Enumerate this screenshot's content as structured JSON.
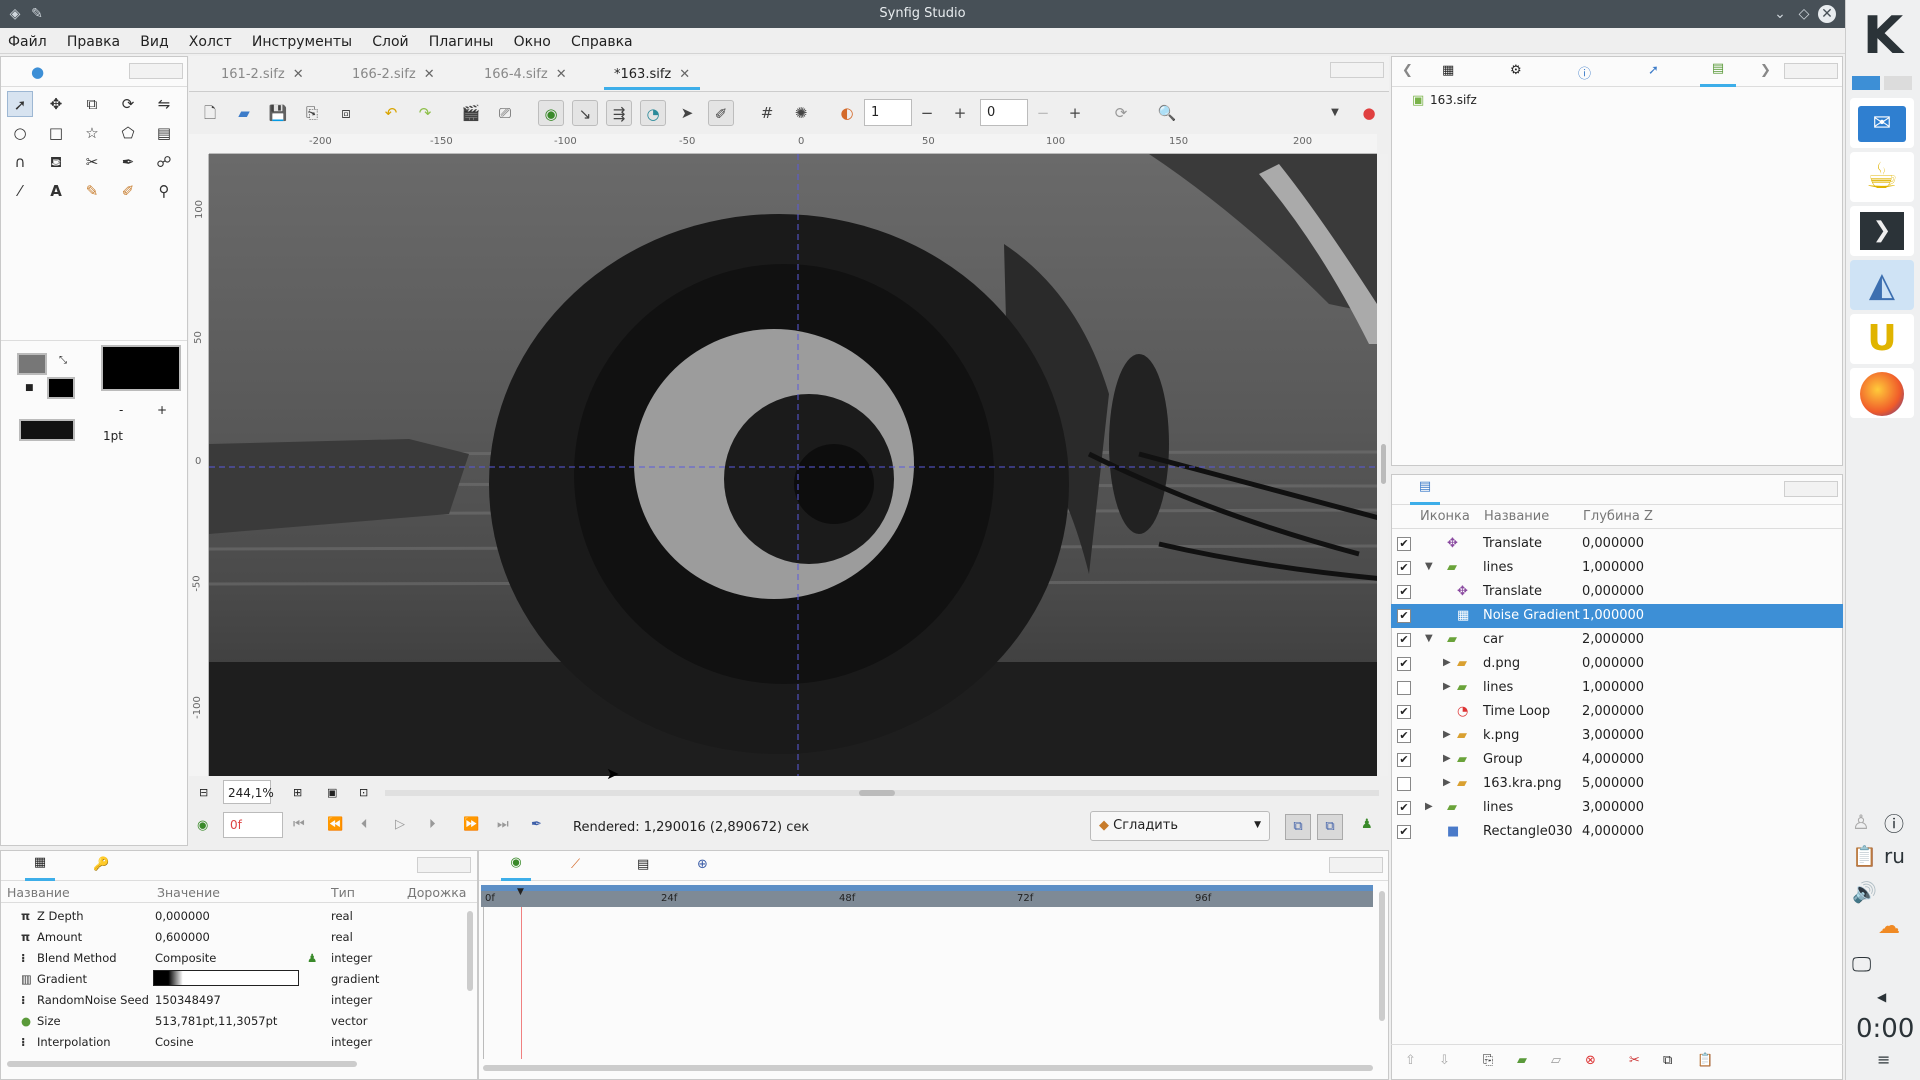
{
  "window": {
    "title": "Synfig Studio"
  },
  "menu": [
    "Файл",
    "Правка",
    "Вид",
    "Холст",
    "Инструменты",
    "Слой",
    "Плагины",
    "Окно",
    "Справка"
  ],
  "tabs": [
    {
      "label": "161-2.sifz",
      "active": false
    },
    {
      "label": "166-2.sifz",
      "active": false
    },
    {
      "label": "166-4.sifz",
      "active": false
    },
    {
      "label": "*163.sifz",
      "active": true
    }
  ],
  "toolbar": {
    "frame_value": "1",
    "offset_value": "0"
  },
  "brush": {
    "size_label": "1pt",
    "minus": "-",
    "plus": "+"
  },
  "ruler": {
    "h_labels": [
      "-200",
      "-150",
      "-100",
      "-50",
      "0",
      "50",
      "100",
      "150",
      "200"
    ],
    "v_labels": [
      "100",
      "50",
      "0",
      "-50",
      "-100"
    ]
  },
  "canvas_footer": {
    "zoom": "244,1%",
    "frame": "0f",
    "render_status": "Rendered: 1,290016 (2,890672) сек",
    "interpolation": "Сгладить"
  },
  "library": {
    "file": "163.sifz"
  },
  "layers": {
    "headers": {
      "icon": "Иконка",
      "name": "Название",
      "depth": "Глубина Z"
    },
    "rows": [
      {
        "name": "Translate",
        "depth": "0,000000",
        "checked": true,
        "indent": 0,
        "icon": "translate-icon",
        "expander": ""
      },
      {
        "name": "lines",
        "depth": "1,000000",
        "checked": true,
        "indent": 0,
        "icon": "folder-icon",
        "expander": "open"
      },
      {
        "name": "Translate",
        "depth": "0,000000",
        "checked": true,
        "indent": 1,
        "icon": "translate-icon",
        "expander": ""
      },
      {
        "name": "Noise Gradient",
        "depth": "1,000000",
        "checked": true,
        "indent": 1,
        "icon": "noise-gradient-icon",
        "expander": "",
        "selected": true
      },
      {
        "name": "car",
        "depth": "2,000000",
        "checked": true,
        "indent": 0,
        "icon": "folder-icon",
        "expander": "open"
      },
      {
        "name": "d.png",
        "depth": "0,000000",
        "checked": true,
        "indent": 1,
        "icon": "folder-image-icon",
        "expander": "closed"
      },
      {
        "name": "lines",
        "depth": "1,000000",
        "checked": false,
        "indent": 1,
        "icon": "folder-icon",
        "expander": "closed"
      },
      {
        "name": "Time Loop",
        "depth": "2,000000",
        "checked": true,
        "indent": 1,
        "icon": "time-loop-icon",
        "expander": ""
      },
      {
        "name": "k.png",
        "depth": "3,000000",
        "checked": true,
        "indent": 1,
        "icon": "folder-image-icon",
        "expander": "closed"
      },
      {
        "name": "Group",
        "depth": "4,000000",
        "checked": true,
        "indent": 1,
        "icon": "folder-icon",
        "expander": "closed"
      },
      {
        "name": "163.kra.png",
        "depth": "5,000000",
        "checked": false,
        "indent": 1,
        "icon": "folder-image-icon",
        "expander": "closed"
      },
      {
        "name": "lines",
        "depth": "3,000000",
        "checked": true,
        "indent": 0,
        "icon": "folder-icon",
        "expander": "closed"
      },
      {
        "name": "Rectangle030",
        "depth": "4,000000",
        "checked": true,
        "indent": 0,
        "icon": "rectangle-icon",
        "expander": ""
      }
    ]
  },
  "params": {
    "headers": {
      "name": "Название",
      "value": "Значение",
      "type": "Тип",
      "track": "Дорожка"
    },
    "rows": [
      {
        "name": "Z Depth",
        "value": "0,000000",
        "type": "real",
        "icon": "pi-icon"
      },
      {
        "name": "Amount",
        "value": "0,600000",
        "type": "real",
        "icon": "pi-icon"
      },
      {
        "name": "Blend Method",
        "value": "Composite",
        "type": "integer",
        "icon": "integer-icon"
      },
      {
        "name": "Gradient",
        "value": "",
        "type": "gradient",
        "icon": "gradient-icon"
      },
      {
        "name": "RandomNoise Seed",
        "value": "150348497",
        "type": "integer",
        "icon": "integer-icon"
      },
      {
        "name": "Size",
        "value": "513,781pt,11,3057pt",
        "type": "vector",
        "icon": "vector-icon"
      },
      {
        "name": "Interpolation",
        "value": "Cosine",
        "type": "integer",
        "icon": "integer-icon"
      }
    ]
  },
  "timetrack": {
    "marks": [
      "0f",
      "24f",
      "48f",
      "72f",
      "96f"
    ]
  },
  "kde_panel": {
    "lang": "ru",
    "clock": "0:00"
  }
}
